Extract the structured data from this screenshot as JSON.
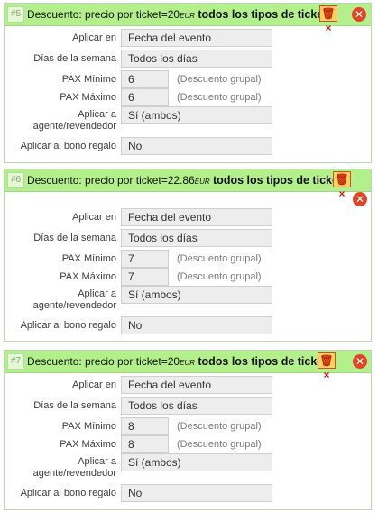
{
  "discounts": [
    {
      "number": "#5",
      "title_prefix": "Descuento: precio por ticket=20",
      "currency": "EUR",
      "title_bold": "todos los tipos de ticket,",
      "delete_label": "🗑×",
      "close_label": "✕",
      "apply_on_label": "Aplicar en",
      "apply_on_value": "Fecha del evento",
      "weekdays_label": "Días de la semana",
      "weekdays_value": "Todos los días",
      "pax_min_label": "PAX Mínimo",
      "pax_min_value": "6",
      "pax_min_hint": "(Descuento grupal)",
      "pax_max_label": "PAX Máximo",
      "pax_max_value": "6",
      "pax_max_hint": "(Descuento grupal)",
      "agent_label": "Aplicar a agente/revendedor",
      "agent_value": "Sí (ambos)",
      "bonus_label": "Aplicar al bono regalo",
      "bonus_value": "No"
    },
    {
      "number": "#6",
      "title_prefix": "Descuento: precio por ticket=22.86",
      "currency": "EUR",
      "title_bold": "todos los tipos de ticket,",
      "delete_label": "🗑×",
      "close_label": "✕",
      "apply_on_label": "Aplicar en",
      "apply_on_value": "Fecha del evento",
      "weekdays_label": "Días de la semana",
      "weekdays_value": "Todos los días",
      "pax_min_label": "PAX Mínimo",
      "pax_min_value": "7",
      "pax_min_hint": "(Descuento grupal)",
      "pax_max_label": "PAX Máximo",
      "pax_max_value": "7",
      "pax_max_hint": "(Descuento grupal)",
      "agent_label": "Aplicar a agente/revendedor",
      "agent_value": "Sí (ambos)",
      "bonus_label": "Aplicar al bono regalo",
      "bonus_value": "No"
    },
    {
      "number": "#7",
      "title_prefix": "Descuento: precio por ticket=20",
      "currency": "EUR",
      "title_bold": "todos los tipos de ticket,",
      "delete_label": "🗑×",
      "close_label": "✕",
      "apply_on_label": "Aplicar en",
      "apply_on_value": "Fecha del evento",
      "weekdays_label": "Días de la semana",
      "weekdays_value": "Todos los días",
      "pax_min_label": "PAX Mínimo",
      "pax_min_value": "8",
      "pax_min_hint": "(Descuento grupal)",
      "pax_max_label": "PAX Máximo",
      "pax_max_value": "8",
      "pax_max_hint": "(Descuento grupal)",
      "agent_label": "Aplicar a agente/revendedor",
      "agent_value": "Sí (ambos)",
      "bonus_label": "Aplicar al bono regalo",
      "bonus_value": "No"
    }
  ],
  "colors": {
    "header_bg": "#b3f08c",
    "close_red": "#e24426",
    "field_bg": "#ededed"
  },
  "icons": {
    "delete": "trash-icon",
    "close": "close-icon"
  }
}
